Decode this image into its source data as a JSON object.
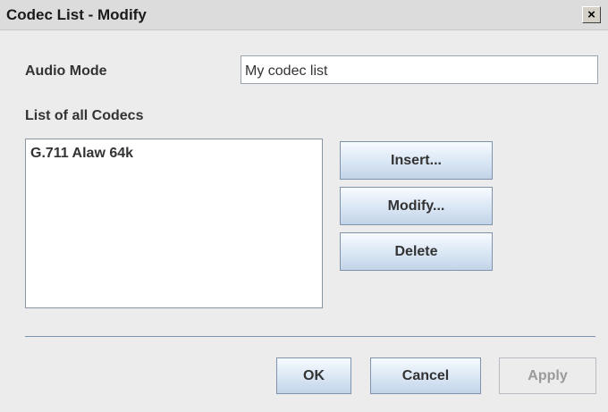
{
  "window": {
    "title": "Codec List - Modify",
    "close_glyph": "×"
  },
  "form": {
    "audio_mode_label": "Audio Mode",
    "audio_mode_value": "My codec list",
    "codecs_label": "List of all Codecs",
    "codecs": [
      "G.711 Alaw 64k"
    ]
  },
  "side_buttons": {
    "insert": "Insert...",
    "modify": "Modify...",
    "delete": "Delete"
  },
  "footer_buttons": {
    "ok": "OK",
    "cancel": "Cancel",
    "apply": "Apply",
    "apply_enabled": false
  }
}
